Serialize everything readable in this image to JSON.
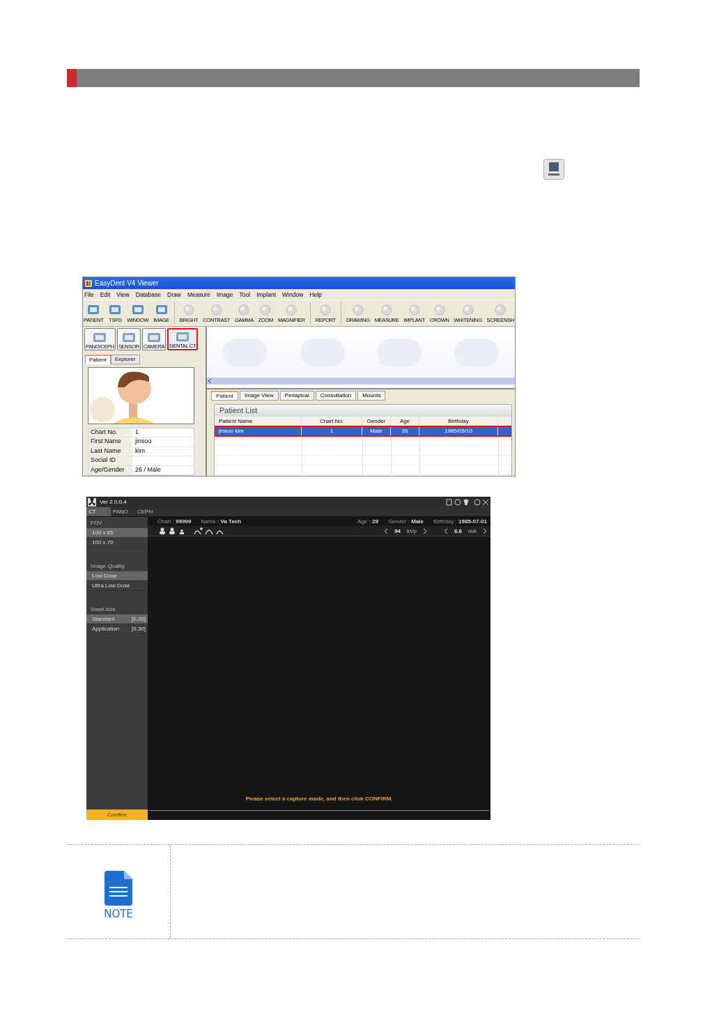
{
  "viewer": {
    "title": "EasyDent V4 Viewer",
    "menu": [
      "File",
      "Edit",
      "View",
      "Database",
      "Draw",
      "Measure",
      "Image",
      "Tool",
      "Implant",
      "Window",
      "Help"
    ],
    "toolbar_groups": [
      {
        "items": [
          "PATIENT",
          "TSFD",
          "WINDOW",
          "IMAGE"
        ]
      },
      {
        "items": [
          "BRIGHT",
          "CONTRAST",
          "GAMMA",
          "ZOOM",
          "MAGNIFIER"
        ]
      },
      {
        "items": [
          "REPORT"
        ]
      },
      {
        "items": [
          "DRAWING",
          "MEASURE",
          "IMPLANT",
          "CROWN",
          "WHITENING",
          "SCREENSH"
        ]
      }
    ],
    "capture_buttons": [
      {
        "label": "PANO/CEPH",
        "selected": false
      },
      {
        "label": "SENSOR",
        "selected": false
      },
      {
        "label": "CAMERA",
        "selected": false
      },
      {
        "label": "DENTAL CT",
        "selected": true
      }
    ],
    "left_tabs": [
      {
        "label": "Patient",
        "selected": true
      },
      {
        "label": "Explorer",
        "selected": false
      }
    ],
    "patient_info": [
      {
        "label": "Chart No.",
        "value": "1"
      },
      {
        "label": "First Name",
        "value": "jinsoo"
      },
      {
        "label": "Last Name",
        "value": "kim"
      },
      {
        "label": "Social ID"
      },
      {
        "label": "Age/Gender",
        "value": "26 / Male"
      }
    ],
    "bottom_tabs": [
      {
        "label": "Patient",
        "selected": true
      },
      {
        "label": "Image View",
        "selected": false
      },
      {
        "label": "Periapical",
        "selected": false
      },
      {
        "label": "Consultation",
        "selected": false
      },
      {
        "label": "Mounts",
        "selected": false
      }
    ],
    "patient_list": {
      "title": "Patient List",
      "columns": [
        "Patient Name",
        "Chart No.",
        "Gender",
        "Age",
        "Birthday"
      ],
      "rows": [
        {
          "cells": [
            "jinsoo kim",
            "1",
            "Male",
            "26",
            "1985/05/10"
          ],
          "selected": true
        }
      ]
    }
  },
  "capture": {
    "version": "Ver 2.0.0.4",
    "tabs": [
      {
        "label": "CT",
        "selected": true
      },
      {
        "label": "PANO",
        "selected": false
      },
      {
        "label": "CEPH",
        "selected": false
      }
    ],
    "sections": [
      {
        "title": "FOV",
        "options": [
          {
            "label": "100 x 85",
            "selected": true
          },
          {
            "label": "100 x 70",
            "selected": false
          }
        ]
      },
      {
        "title": "Image Quality",
        "options": [
          {
            "label": "Low Dose",
            "selected": true
          },
          {
            "label": "Ultra Low Dose",
            "selected": false
          }
        ]
      },
      {
        "title": "Voxel size",
        "options": [
          {
            "label": "Standard",
            "value": "[0.20]",
            "selected": true
          },
          {
            "label": "Application",
            "value": "[0.30]",
            "selected": false
          }
        ]
      }
    ],
    "info_left": [
      {
        "label": "Chart :",
        "value": "99999"
      },
      {
        "label": "Name :",
        "value": "Va Tech"
      }
    ],
    "info_right": [
      {
        "label": "Age :",
        "value": "29"
      },
      {
        "label": "Gender :",
        "value": "Male"
      },
      {
        "label": "Birthday :",
        "value": "1985-07-01"
      }
    ],
    "exposure": [
      {
        "value": "94",
        "unit": "kVp"
      },
      {
        "value": "6.6",
        "unit": "mA"
      }
    ],
    "message": "Please select a capture mode, and then click CONFIRM.",
    "confirm": "Confirm"
  },
  "note": {
    "label": "NOTE"
  }
}
